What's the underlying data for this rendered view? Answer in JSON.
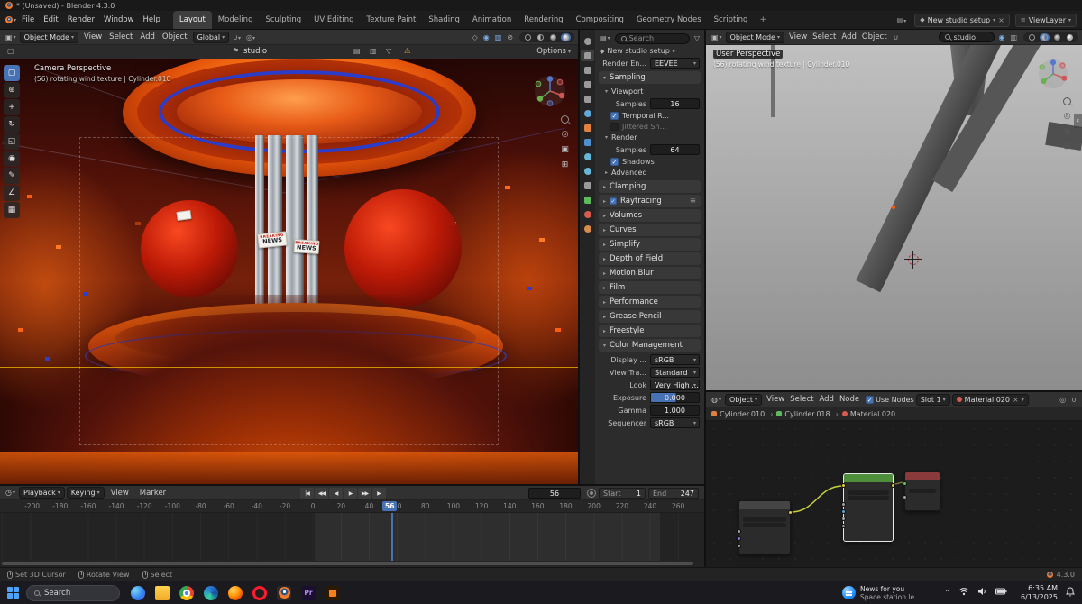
{
  "titlebar": {
    "title": "* (Unsaved) - Blender 4.3.0"
  },
  "topbar": {
    "menus": [
      "File",
      "Edit",
      "Render",
      "Window",
      "Help"
    ],
    "workspaces": [
      {
        "label": "Layout",
        "active": true
      },
      {
        "label": "Modeling"
      },
      {
        "label": "Sculpting"
      },
      {
        "label": "UV Editing"
      },
      {
        "label": "Texture Paint"
      },
      {
        "label": "Shading"
      },
      {
        "label": "Animation"
      },
      {
        "label": "Rendering"
      },
      {
        "label": "Compositing"
      },
      {
        "label": "Geometry Nodes"
      },
      {
        "label": "Scripting"
      }
    ],
    "add_workspace": "+",
    "scene_name": "New studio setup",
    "viewlayer_name": "ViewLayer"
  },
  "viewport_left": {
    "mode": "Object Mode",
    "menus": [
      "View",
      "Select",
      "Add",
      "Object"
    ],
    "orientation": "Global",
    "tool_settings": {
      "collection": "studio",
      "options_label": "Options"
    },
    "overlay": {
      "line1": "Camera Perspective",
      "line2": "(56) rotating wind texture | Cylinder.010"
    },
    "tools": [
      {
        "name": "select-box-tool",
        "glyph": "▢",
        "active": true
      },
      {
        "name": "cursor-tool",
        "glyph": "⊕"
      },
      {
        "name": "move-tool",
        "glyph": "+"
      },
      {
        "name": "rotate-tool",
        "glyph": "↻"
      },
      {
        "name": "scale-tool",
        "glyph": "◱"
      },
      {
        "name": "transform-tool",
        "glyph": "◉"
      },
      {
        "name": "annotate-tool",
        "glyph": "✎"
      },
      {
        "name": "measure-tool",
        "glyph": "∠"
      },
      {
        "name": "add-cube-tool",
        "glyph": "▦"
      }
    ],
    "scene_signs": {
      "line1": "BREAKING",
      "line2": "NEWS"
    }
  },
  "properties": {
    "search_placeholder": "Search",
    "pinned_id": "New studio setup",
    "tabs": [
      {
        "n": "tool"
      },
      {
        "n": "render",
        "active": true
      },
      {
        "n": "output"
      },
      {
        "n": "view-layer"
      },
      {
        "n": "scene"
      },
      {
        "n": "world"
      },
      {
        "n": "object"
      },
      {
        "n": "modifiers"
      },
      {
        "n": "particles"
      },
      {
        "n": "physics"
      },
      {
        "n": "constraints"
      },
      {
        "n": "data"
      },
      {
        "n": "material"
      },
      {
        "n": "texture"
      }
    ],
    "render_engine": {
      "label": "Render En...",
      "value": "EEVEE"
    },
    "sampling": {
      "title": "Sampling",
      "viewport_title": "Viewport",
      "viewport_samples_label": "Samples",
      "viewport_samples_value": "16",
      "temporal_label": "Temporal R...",
      "jittered_label": "Jittered Sh...",
      "render_title": "Render",
      "render_samples_label": "Samples",
      "render_samples_value": "64",
      "shadows_label": "Shadows",
      "advanced_label": "Advanced"
    },
    "collapsed_sections": [
      {
        "label": "Clamping"
      },
      {
        "label": "Raytracing",
        "checkbox": true,
        "menu": true
      },
      {
        "label": "Volumes"
      },
      {
        "label": "Curves"
      },
      {
        "label": "Simplify"
      },
      {
        "label": "Depth of Field"
      },
      {
        "label": "Motion Blur"
      },
      {
        "label": "Film"
      },
      {
        "label": "Performance"
      },
      {
        "label": "Grease Pencil"
      },
      {
        "label": "Freestyle"
      }
    ],
    "color_management": {
      "title": "Color Management",
      "rows": [
        {
          "label": "Display ...",
          "value": "sRGB",
          "type": "dropdown"
        },
        {
          "label": "View Tra...",
          "value": "Standard",
          "type": "dropdown"
        },
        {
          "label": "Look",
          "value": "Very High ...",
          "type": "dropdown"
        },
        {
          "label": "Exposure",
          "value": "0.000",
          "type": "slider-fill"
        },
        {
          "label": "Gamma",
          "value": "1.000",
          "type": "slider"
        },
        {
          "label": "Sequencer",
          "value": "sRGB",
          "type": "dropdown"
        }
      ]
    }
  },
  "viewport_right": {
    "mode": "Object Mode",
    "menus": [
      "View",
      "Select",
      "Add",
      "Object"
    ],
    "search_value": "studio",
    "overlay": {
      "line1": "User Perspective",
      "line2": "(56) rotating wind texture | Cylinder.010"
    }
  },
  "node_editor": {
    "shader_type": "Object",
    "menus": [
      "View",
      "Select",
      "Add",
      "Node"
    ],
    "use_nodes_label": "Use Nodes",
    "slot": "Slot 1",
    "material": "Material.020",
    "breadcrumb": [
      {
        "label": "Cylinder.010",
        "icon": "object"
      },
      {
        "label": "Cylinder.018",
        "icon": "mesh"
      },
      {
        "label": "Material.020",
        "icon": "material"
      }
    ]
  },
  "timeline": {
    "menus_dd": [
      "Playback",
      "Keying"
    ],
    "menus": [
      "View",
      "Marker"
    ],
    "transport": [
      {
        "name": "jump-to-start-button",
        "glyph": "|◀"
      },
      {
        "name": "prev-keyframe-button",
        "glyph": "◀◀"
      },
      {
        "name": "play-reverse-button",
        "glyph": "◀"
      },
      {
        "name": "play-button",
        "glyph": "▶"
      },
      {
        "name": "next-keyframe-button",
        "glyph": "▶▶"
      },
      {
        "name": "jump-to-end-button",
        "glyph": "▶|"
      }
    ],
    "current_frame": "56",
    "start_label": "Start",
    "start_value": "1",
    "end_label": "End",
    "end_value": "247",
    "ruler": [
      "-200",
      "-180",
      "-160",
      "-140",
      "-120",
      "-100",
      "-80",
      "-60",
      "-40",
      "-20",
      "0",
      "20",
      "40",
      "60",
      "80",
      "100",
      "120",
      "140",
      "160",
      "180",
      "200",
      "220",
      "240",
      "260"
    ]
  },
  "statusbar": {
    "items": [
      {
        "label": "Set 3D Cursor"
      },
      {
        "label": "Rotate View"
      },
      {
        "label": "Select"
      }
    ],
    "version": "4.3.0"
  },
  "taskbar": {
    "search_label": "Search",
    "apps": [
      {
        "n": "copilot"
      },
      {
        "n": "file-explorer"
      },
      {
        "n": "chrome"
      },
      {
        "n": "edge"
      },
      {
        "n": "firefox"
      },
      {
        "n": "opera"
      },
      {
        "n": "blender",
        "active": true
      },
      {
        "n": "premiere",
        "label": "Pr"
      },
      {
        "n": "illustrator"
      }
    ],
    "widget": {
      "line1": "News for you",
      "line2": "Space station le..."
    },
    "time": "6:35 AM",
    "date": "6/13/2025"
  }
}
